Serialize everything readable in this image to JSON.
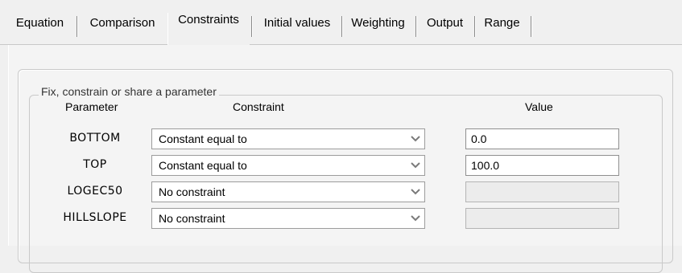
{
  "tabs": [
    {
      "label": "Equation",
      "active": false
    },
    {
      "label": "Comparison",
      "active": false
    },
    {
      "label": "Constraints",
      "active": true
    },
    {
      "label": "Initial values",
      "active": false
    },
    {
      "label": "Weighting",
      "active": false
    },
    {
      "label": "Output",
      "active": false
    },
    {
      "label": "Range",
      "active": false
    }
  ],
  "group": {
    "title": "Fix, constrain or share a parameter"
  },
  "columns": {
    "parameter": "Parameter",
    "constraint": "Constraint",
    "value": "Value"
  },
  "rows": [
    {
      "parameter": "BOTTOM",
      "constraint": "Constant equal to",
      "value": "0.0",
      "value_enabled": true
    },
    {
      "parameter": "TOP",
      "constraint": "Constant equal to",
      "value": "100.0",
      "value_enabled": true
    },
    {
      "parameter": "LOGEC50",
      "constraint": "No constraint",
      "value": "",
      "value_enabled": false
    },
    {
      "parameter": "HILLSLOPE",
      "constraint": "No constraint",
      "value": "",
      "value_enabled": false
    }
  ],
  "icons": {
    "dropdown": "chevron-down-icon"
  }
}
